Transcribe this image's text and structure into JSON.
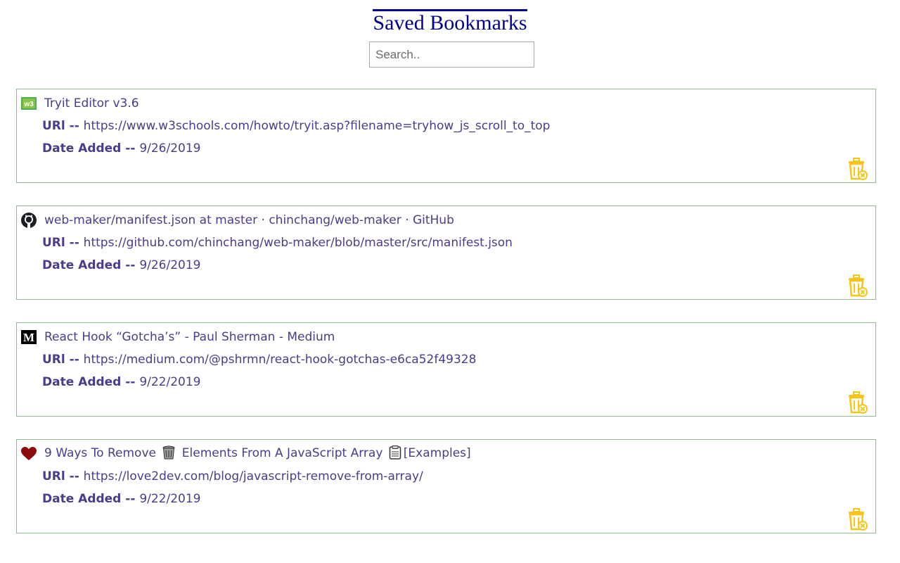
{
  "page": {
    "title": "Saved Bookmarks"
  },
  "search": {
    "placeholder": "Search..",
    "value": ""
  },
  "labels": {
    "url": "URl -- ",
    "date": "Date Added -- "
  },
  "colors": {
    "title": "#00008b",
    "text": "#483d8b",
    "card_border": "#8fbc8f",
    "trash_icon": "#f5c518"
  },
  "bookmarks": [
    {
      "favicon": "w3schools-icon",
      "title": "Tryit Editor v3.6",
      "url": "https://www.w3schools.com/howto/tryit.asp?filename=tryhow_js_scroll_to_top",
      "date": "9/26/2019"
    },
    {
      "favicon": "github-icon",
      "title": "web-maker/manifest.json at master · chinchang/web-maker · GitHub",
      "url": "https://github.com/chinchang/web-maker/blob/master/src/manifest.json",
      "date": "9/26/2019"
    },
    {
      "favicon": "medium-icon",
      "title": "React Hook “Gotcha’s” - Paul Sherman - Medium",
      "url": "https://medium.com/@pshrmn/react-hook-gotchas-e6ca52f49328",
      "date": "9/22/2019"
    },
    {
      "favicon": "heart-icon",
      "title_parts": [
        "9 Ways To Remove",
        "Elements From A JavaScript Array",
        "[Examples]"
      ],
      "title_icons": [
        "wastebasket-icon",
        "clipboard-icon"
      ],
      "url": "https://love2dev.com/blog/javascript-remove-from-array/",
      "date": "9/22/2019"
    }
  ]
}
